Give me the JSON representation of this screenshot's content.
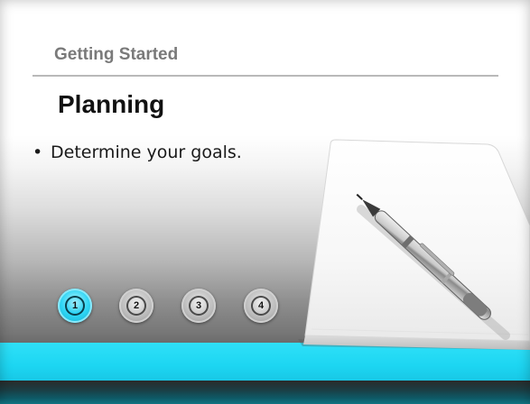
{
  "slide": {
    "section_title": "Getting Started",
    "title": "Planning",
    "bullets": [
      {
        "marker": "•",
        "text": "Determine your goals."
      }
    ]
  },
  "steps": {
    "items": [
      "1",
      "2",
      "3",
      "4"
    ],
    "active_index": 0
  },
  "colors": {
    "accent": "#1dd6f2",
    "footer_dark": "#0f5d6a",
    "section_title": "#7a7a7a",
    "title": "#111111"
  },
  "image": {
    "description_icon": "notepad-with-pen-icon"
  }
}
